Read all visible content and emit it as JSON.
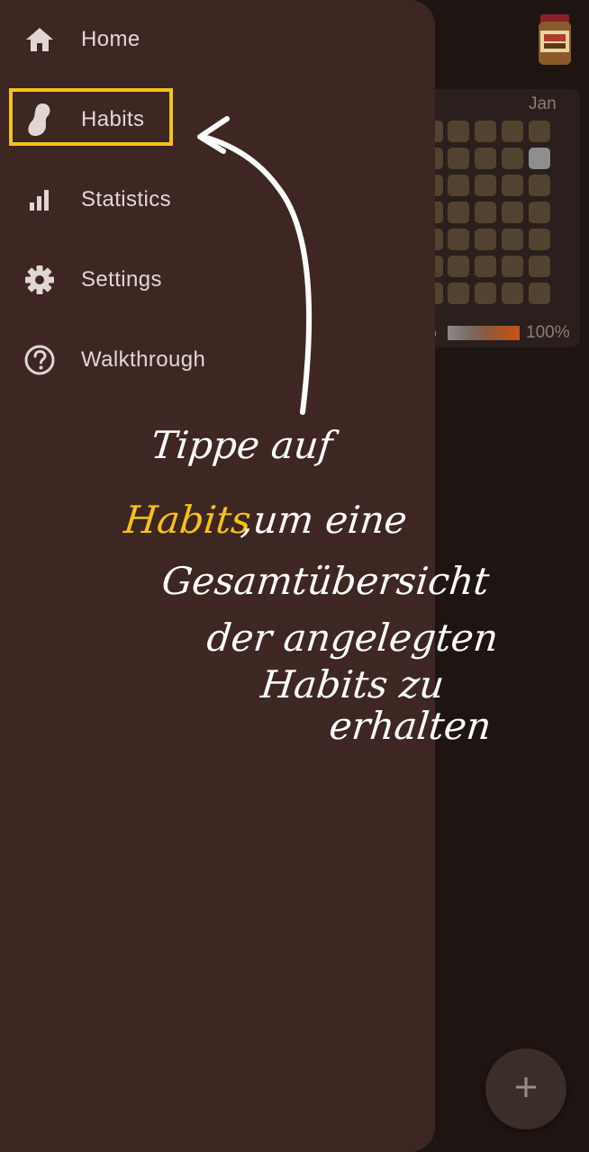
{
  "background": {
    "month_label": "Jan",
    "legend_min": "%",
    "legend_max": "100%",
    "fab_icon": "plus-icon",
    "heatmap_highlight_cell": {
      "row": 1,
      "col": 5
    }
  },
  "drawer": {
    "items": [
      {
        "label": "Home",
        "icon": "home-icon"
      },
      {
        "label": "Habits",
        "icon": "peanut-icon"
      },
      {
        "label": "Statistics",
        "icon": "bar-chart-icon"
      },
      {
        "label": "Settings",
        "icon": "gear-icon"
      },
      {
        "label": "Walkthrough",
        "icon": "help-circle-icon"
      }
    ],
    "highlighted_item": "Habits"
  },
  "annotation": {
    "line1": "Tippe auf",
    "line2_highlight": "Habits",
    "line2_rest": ",um eine",
    "line3": "Gesamtübersicht",
    "line4": "der angelegten",
    "line5": "Habits zu",
    "line6": "erhalten"
  },
  "colors": {
    "drawer_bg": "#3e2723",
    "app_bg": "#1e1412",
    "highlight": "#f5c21b",
    "text": "#e1d6d2"
  }
}
